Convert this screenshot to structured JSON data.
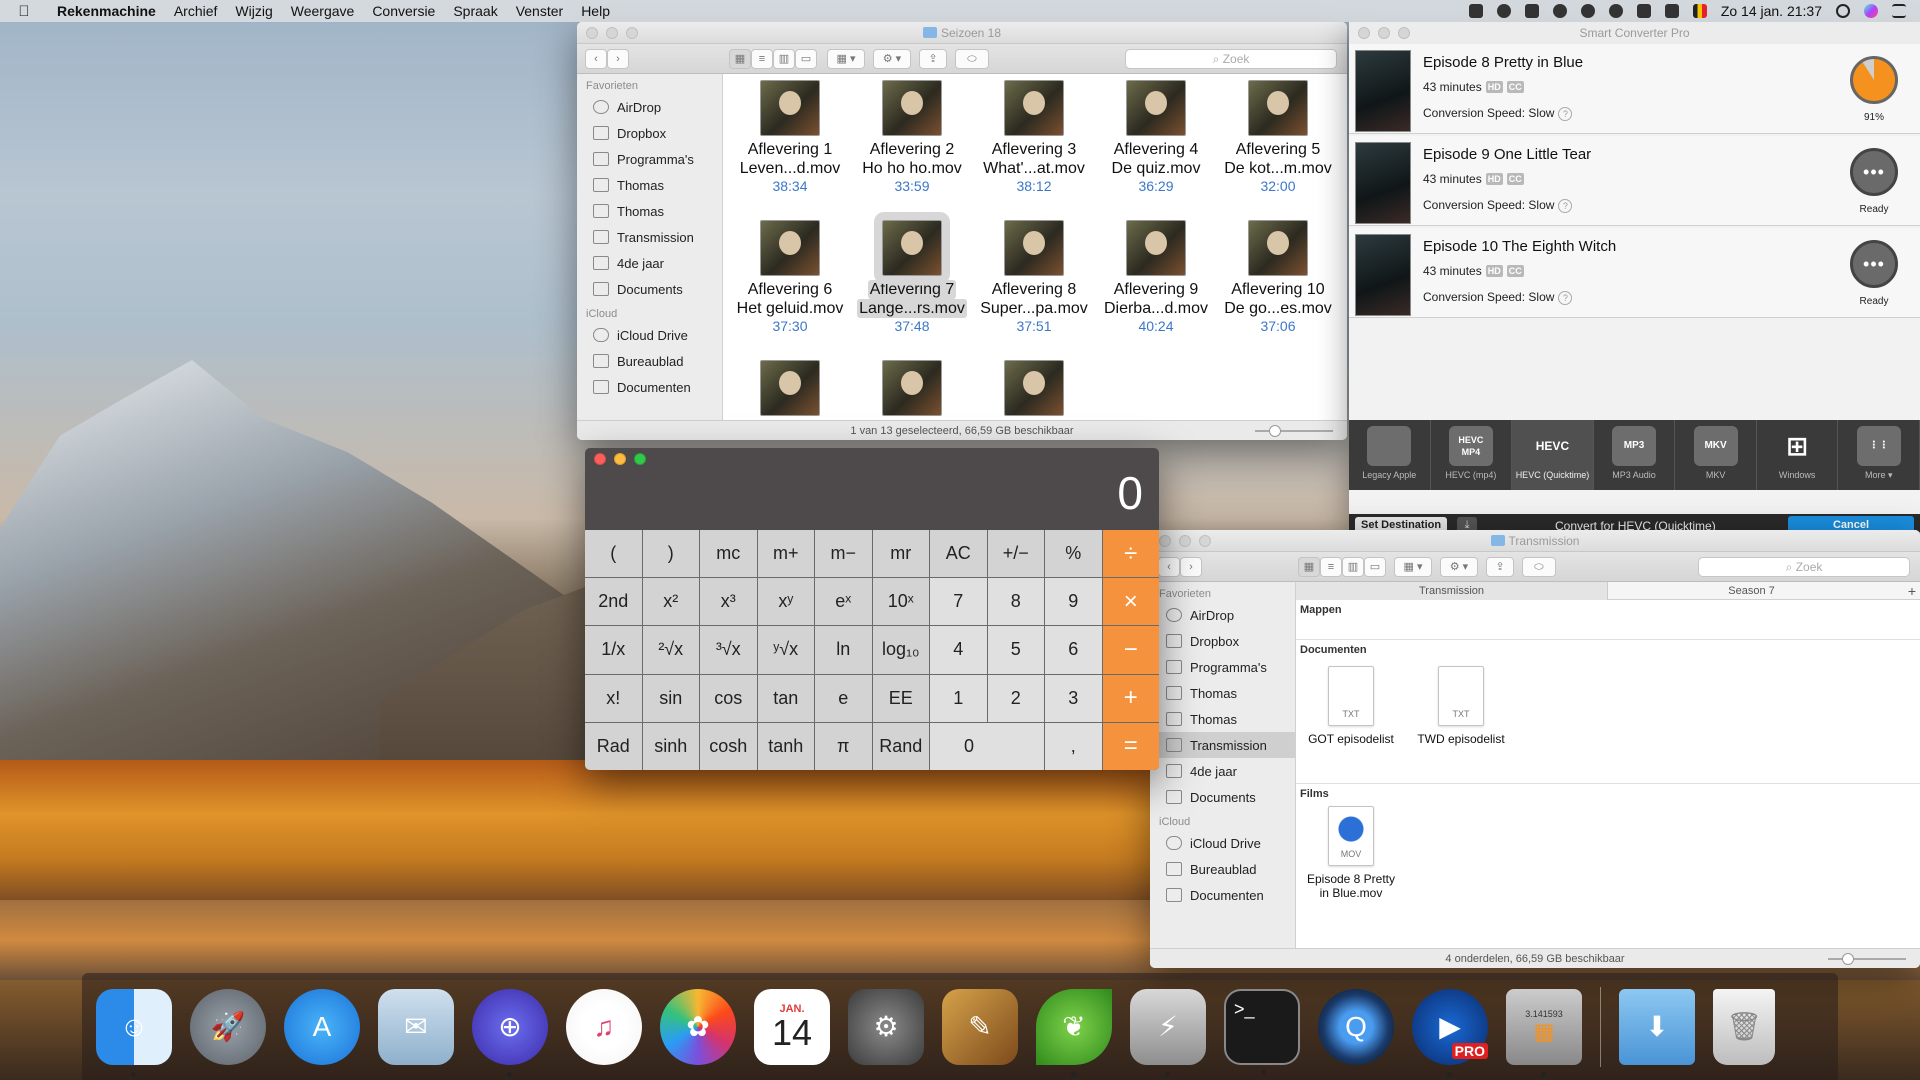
{
  "menubar": {
    "app": "Rekenmachine",
    "items": [
      "Archief",
      "Wijzig",
      "Weergave",
      "Conversie",
      "Spraak",
      "Venster",
      "Help"
    ],
    "clock": "Zo 14 jan.  21:37"
  },
  "finder1": {
    "title": "Seizoen 18",
    "search_placeholder": "Zoek",
    "fav_header": "Favorieten",
    "favorites": [
      "AirDrop",
      "Dropbox",
      "Programma's",
      "Thomas",
      "Thomas",
      "Transmission",
      "4de jaar",
      "Documents"
    ],
    "icloud_header": "iCloud",
    "icloud": [
      "iCloud Drive",
      "Bureaublad",
      "Documenten"
    ],
    "files": [
      {
        "l1": "Aflevering 1",
        "l2": "Leven...d.mov",
        "dur": "38:34"
      },
      {
        "l1": "Aflevering 2",
        "l2": "Ho ho ho.mov",
        "dur": "33:59"
      },
      {
        "l1": "Aflevering 3",
        "l2": "What'...at.mov",
        "dur": "38:12"
      },
      {
        "l1": "Aflevering 4",
        "l2": "De quiz.mov",
        "dur": "36:29"
      },
      {
        "l1": "Aflevering 5",
        "l2": "De kot...m.mov",
        "dur": "32:00"
      },
      {
        "l1": "Aflevering 6",
        "l2": "Het geluid.mov",
        "dur": "37:30"
      },
      {
        "l1": "Aflevering 7",
        "l2": "Lange...rs.mov",
        "dur": "37:48"
      },
      {
        "l1": "Aflevering 8",
        "l2": "Super...pa.mov",
        "dur": "37:51"
      },
      {
        "l1": "Aflevering 9",
        "l2": "Dierba...d.mov",
        "dur": "40:24"
      },
      {
        "l1": "Aflevering 10",
        "l2": "De go...es.mov",
        "dur": "37:06"
      }
    ],
    "status": "1 van 13 geselecteerd, 66,59 GB beschikbaar"
  },
  "calculator": {
    "display": "0",
    "keys": [
      "(",
      ")",
      "mc",
      "m+",
      "m−",
      "mr",
      "AC",
      "+/−",
      "%",
      "÷",
      "2nd",
      "x²",
      "x³",
      "xʸ",
      "eˣ",
      "10ˣ",
      "7",
      "8",
      "9",
      "×",
      "1/x",
      "²√x",
      "³√x",
      "ʸ√x",
      "ln",
      "log₁₀",
      "4",
      "5",
      "6",
      "−",
      "x!",
      "sin",
      "cos",
      "tan",
      "e",
      "EE",
      "1",
      "2",
      "3",
      "+",
      "Rad",
      "sinh",
      "cosh",
      "tanh",
      "π",
      "Rand",
      "0",
      ",",
      "="
    ]
  },
  "converter": {
    "title": "Smart Converter Pro",
    "episodes": [
      {
        "title": "Episode 8 Pretty in Blue",
        "minutes": "43 minutes",
        "speed": "Conversion Speed: Slow",
        "status": "91%",
        "progress": 0.91
      },
      {
        "title": "Episode 9 One Little Tear",
        "minutes": "43 minutes",
        "speed": "Conversion Speed: Slow",
        "status": "Ready"
      },
      {
        "title": "Episode 10 The Eighth Witch",
        "minutes": "43 minutes",
        "speed": "Conversion Speed: Slow",
        "status": "Ready"
      }
    ],
    "badges": [
      "HD",
      "CC"
    ],
    "formats": [
      {
        "icon": "",
        "label": "Legacy Apple"
      },
      {
        "icon": "HEVC MP4",
        "label": "HEVC (mp4)"
      },
      {
        "icon": "HEVC",
        "label": "HEVC (Quicktime)"
      },
      {
        "icon": "MP3",
        "label": "MP3 Audio"
      },
      {
        "icon": "MKV",
        "label": "MKV"
      },
      {
        "icon": "⊞",
        "label": "Windows"
      },
      {
        "icon": "⋮⋮",
        "label": "More ▾"
      }
    ],
    "set_destination": "Set Destination",
    "convert_label": "Convert for HEVC (Quicktime)",
    "cancel": "Cancel"
  },
  "finder2": {
    "title": "Transmission",
    "search_placeholder": "Zoek",
    "path_left": "Transmission",
    "path_right": "Season 7",
    "fav_header": "Favorieten",
    "favorites": [
      "AirDrop",
      "Dropbox",
      "Programma's",
      "Thomas",
      "Thomas",
      "Transmission",
      "4de jaar",
      "Documents"
    ],
    "icloud_header": "iCloud",
    "icloud": [
      "iCloud Drive",
      "Bureaublad",
      "Documenten"
    ],
    "sec_folders": "Mappen",
    "sec_docs": "Documenten",
    "docs": [
      {
        "type": "TXT",
        "name": "GOT episodelist"
      },
      {
        "type": "TXT",
        "name": "TWD episodelist"
      }
    ],
    "sec_films": "Films",
    "film": {
      "type": "MOV",
      "name1": "Episode 8 Pretty",
      "name2": "in Blue.mov"
    },
    "status": "4 onderdelen, 66,59 GB beschikbaar"
  },
  "dock": {
    "calendar_month": "JAN.",
    "calendar_day": "14",
    "pro_label": "PRO",
    "calc_readout": "3.141593"
  },
  "colors": {
    "accent": "#f5921f",
    "cancel": "#1a8fe0",
    "link": "#3b77c9"
  }
}
